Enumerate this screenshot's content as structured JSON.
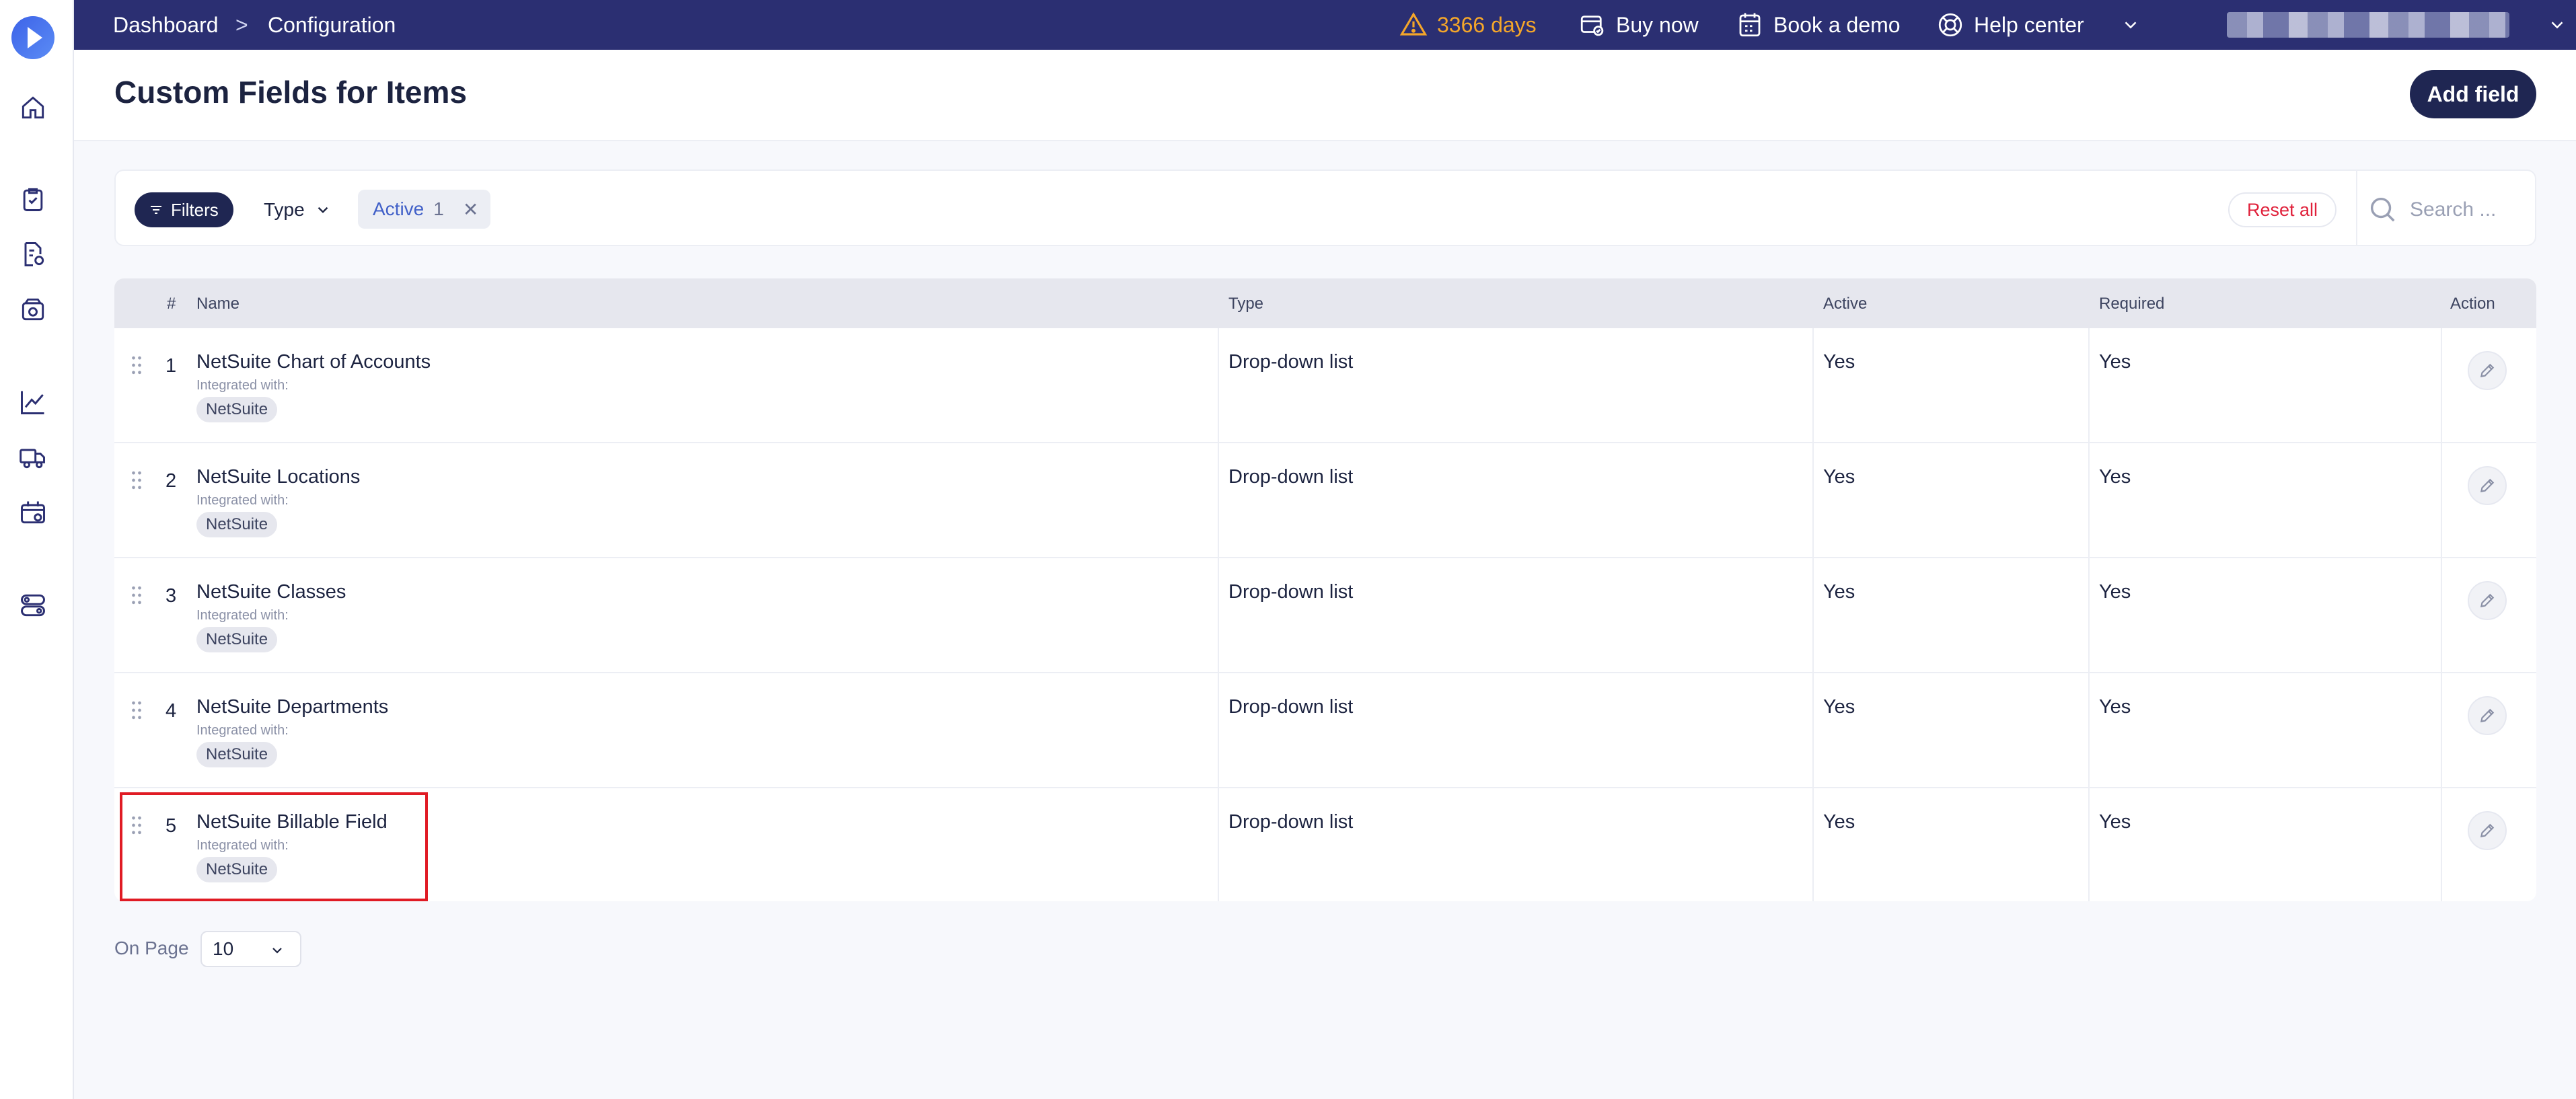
{
  "breadcrumb": [
    "Dashboard",
    "Configuration"
  ],
  "topbar": {
    "trial": "3366 days",
    "buy_now": "Buy now",
    "book_demo": "Book a demo",
    "help_center": "Help center"
  },
  "page": {
    "title": "Custom Fields for Items",
    "add_button": "Add field"
  },
  "filters": {
    "filters_label": "Filters",
    "type_label": "Type",
    "active_chip": "Active",
    "active_count": "1",
    "reset_label": "Reset all",
    "search_placeholder": "Search ..."
  },
  "table": {
    "headers": {
      "index": "#",
      "name": "Name",
      "type": "Type",
      "active": "Active",
      "required": "Required",
      "action": "Action"
    },
    "integrated_label": "Integrated with:",
    "rows": [
      {
        "index": "1",
        "name": "NetSuite Chart of Accounts",
        "integration": "NetSuite",
        "type": "Drop-down list",
        "active": "Yes",
        "required": "Yes"
      },
      {
        "index": "2",
        "name": "NetSuite Locations",
        "integration": "NetSuite",
        "type": "Drop-down list",
        "active": "Yes",
        "required": "Yes"
      },
      {
        "index": "3",
        "name": "NetSuite Classes",
        "integration": "NetSuite",
        "type": "Drop-down list",
        "active": "Yes",
        "required": "Yes"
      },
      {
        "index": "4",
        "name": "NetSuite Departments",
        "integration": "NetSuite",
        "type": "Drop-down list",
        "active": "Yes",
        "required": "Yes"
      },
      {
        "index": "5",
        "name": "NetSuite Billable Field",
        "integration": "NetSuite",
        "type": "Drop-down list",
        "active": "Yes",
        "required": "Yes"
      }
    ]
  },
  "pager": {
    "label": "On Page",
    "value": "10"
  },
  "colors": {
    "topbar": "#2b2f72",
    "accent": "#1f2652",
    "warning": "#f4a62a",
    "danger": "#e0213b",
    "highlight": "#e01b24"
  },
  "icons": [
    "logo-icon",
    "home-icon",
    "clipboard-check-icon",
    "document-settings-icon",
    "box-check-icon",
    "chart-line-icon",
    "truck-icon",
    "calendar-box-icon",
    "toggles-icon",
    "warning-icon",
    "cart-icon",
    "calendar-icon",
    "lifebuoy-icon",
    "user-icon",
    "filter-icon",
    "search-icon",
    "drag-handle-icon",
    "pencil-icon"
  ]
}
